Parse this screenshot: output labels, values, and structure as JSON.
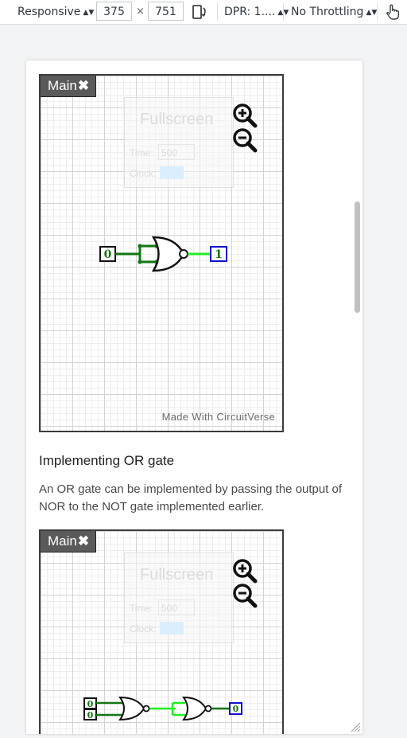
{
  "toolbar": {
    "device": "Responsive",
    "width": "375",
    "times": "×",
    "height": "751",
    "dpr": "DPR: 1....",
    "throttling": "No Throttling"
  },
  "simulator1": {
    "tab_label": "Main",
    "tab_close": "✖",
    "panel": {
      "fullscreen": "Fullscreen",
      "time_label": "Time:",
      "time_value": "500",
      "clock_label": "Clock:"
    },
    "watermark": "Made With CircuitVerse",
    "input_value": "0",
    "output_value": "1"
  },
  "article": {
    "heading": "Implementing OR gate",
    "paragraph": "An OR gate can be implemented by passing the output of NOR to the NOT gate implemented earlier."
  },
  "simulator2": {
    "tab_label": "Main",
    "tab_close": "✖",
    "panel": {
      "fullscreen": "Fullscreen",
      "time_label": "Time:",
      "time_value": "500",
      "clock_label": "Clock:"
    },
    "input_a": "0",
    "input_b": "0",
    "output_value": "0"
  },
  "colors": {
    "wire_dark": "#117711",
    "wire_light": "#22ee22",
    "output_border": "#1111cc"
  }
}
